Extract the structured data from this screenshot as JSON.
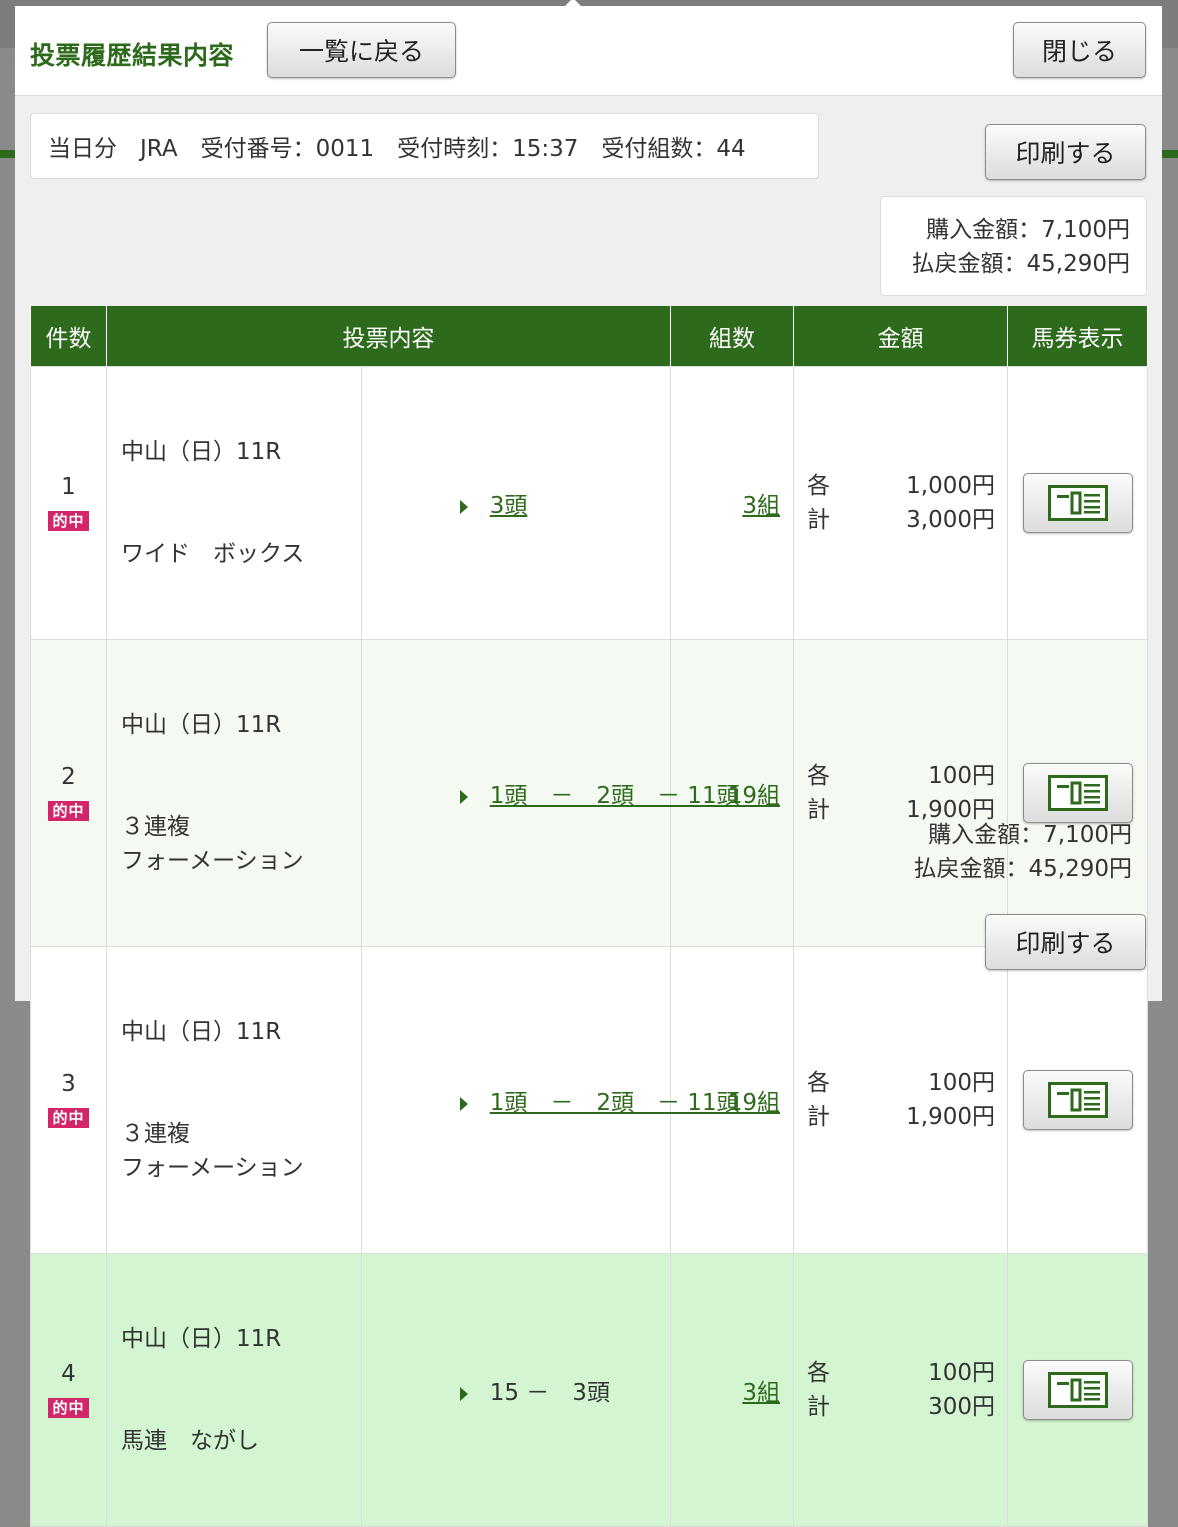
{
  "header": {
    "title": "投票履歴結果内容",
    "back_label": "一覧に戻る",
    "close_label": "閉じる"
  },
  "info": {
    "text": "当日分　JRA　受付番号：0011　受付時刻：15:37　受付組数：44"
  },
  "print_label": "印刷する",
  "summary": {
    "purchase": "購入金額：7,100円",
    "payout": "払戻金額：45,290円"
  },
  "table": {
    "headers": {
      "count": "件数",
      "content": "投票内容",
      "combos": "組数",
      "amount": "金額",
      "ticket": "馬券表示"
    },
    "rows": [
      {
        "num": "1",
        "badge": "的中",
        "race": "中山（日）11R",
        "bet_type": "ワイド　ボックス",
        "selection": "3頭",
        "combos": "3組",
        "each_label": "各",
        "each": "1,000円",
        "total_label": "計",
        "total": "3,000円"
      },
      {
        "num": "2",
        "badge": "的中",
        "race": "中山（日）11R",
        "bet_type": "３連複\nフォーメーション",
        "selection": "1頭　－　2頭　－ 11頭",
        "combos": "19組",
        "each_label": "各",
        "each": "100円",
        "total_label": "計",
        "total": "1,900円"
      },
      {
        "num": "3",
        "badge": "的中",
        "race": "中山（日）11R",
        "bet_type": "３連複\nフォーメーション",
        "selection": "1頭　－　2頭　－ 11頭",
        "combos": "19組",
        "each_label": "各",
        "each": "100円",
        "total_label": "計",
        "total": "1,900円"
      },
      {
        "num": "4",
        "badge": "的中",
        "race": "中山（日）11R",
        "bet_type": "馬連　ながし",
        "selection": "15 －　3頭",
        "combos": "3組",
        "each_label": "各",
        "each": "100円",
        "total_label": "計",
        "total": "300円"
      }
    ]
  },
  "icons": {
    "ticket": "ticket-icon",
    "arrow": "triangle-right-icon"
  },
  "colors": {
    "brand_green": "#2e6a1c",
    "hit_badge": "#d3266a",
    "highlight_row": "#d4f5d2"
  }
}
